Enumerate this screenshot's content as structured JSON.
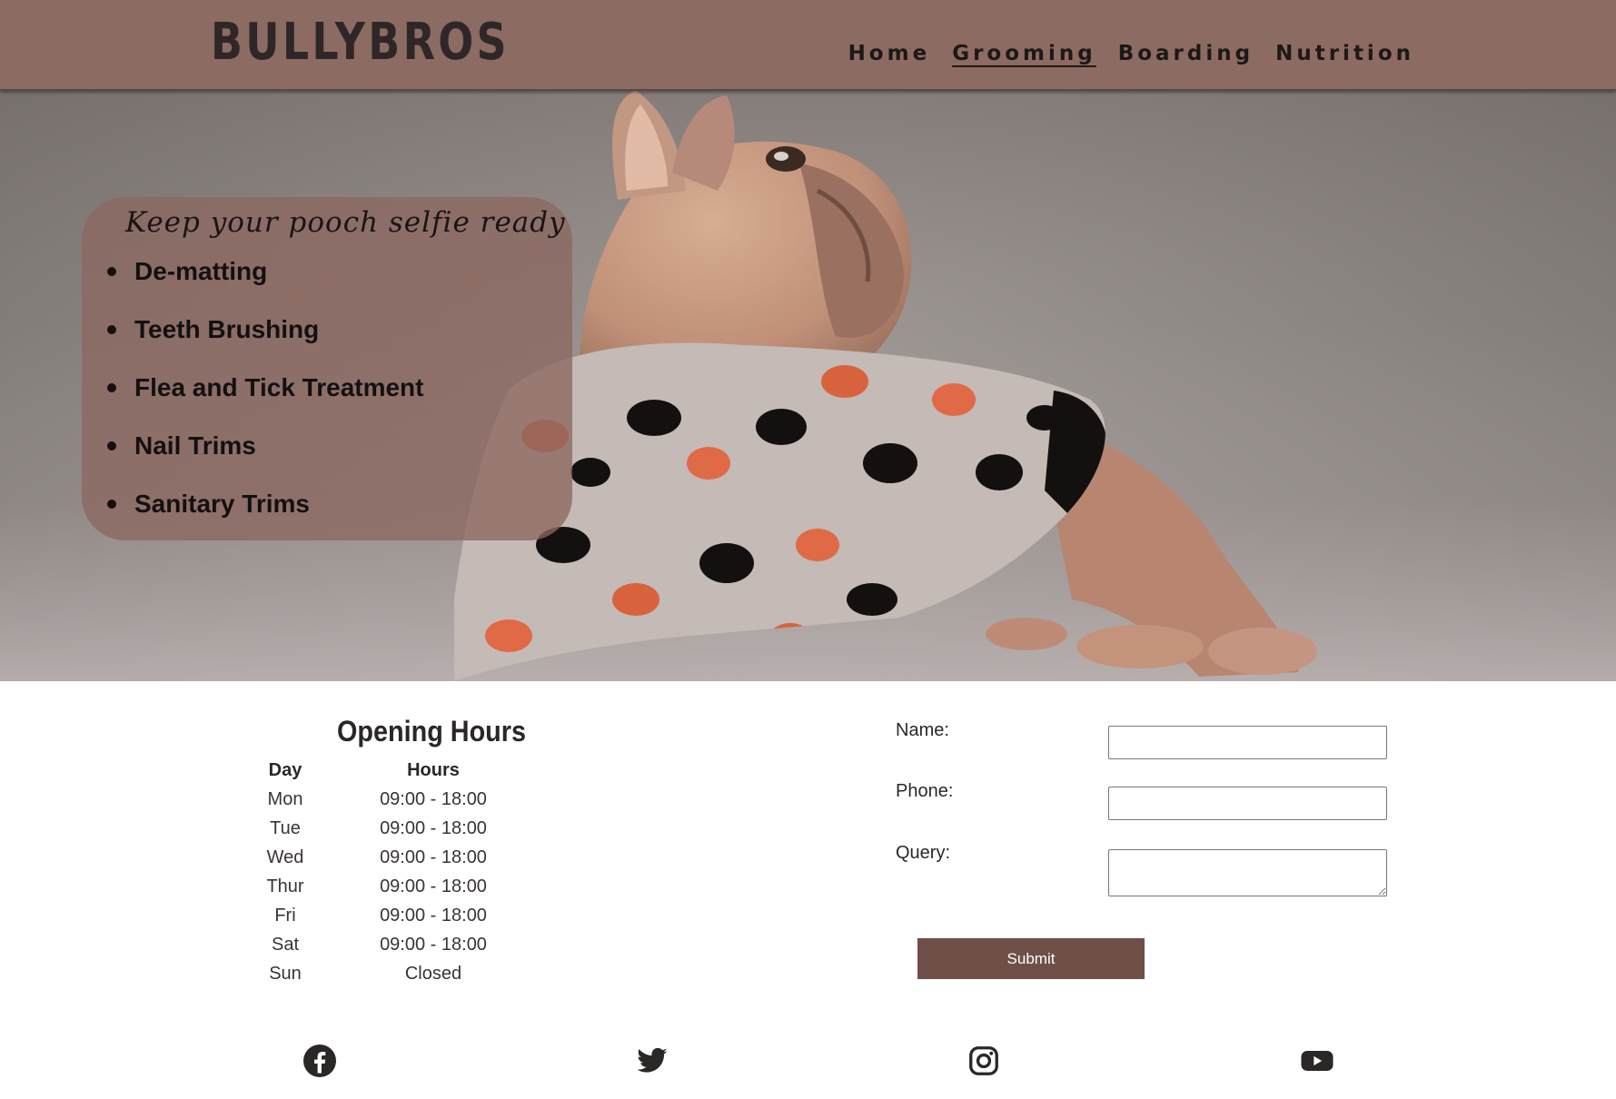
{
  "header": {
    "logo": "BULLYBROS",
    "nav": [
      {
        "label": "Home",
        "active": false
      },
      {
        "label": "Grooming",
        "active": true
      },
      {
        "label": "Boarding",
        "active": false
      },
      {
        "label": "Nutrition",
        "active": false
      }
    ]
  },
  "hero": {
    "tagline": "Keep your pooch selfie ready",
    "services": [
      "De-matting",
      "Teeth Brushing",
      "Flea and Tick Treatment",
      "Nail Trims",
      "Sanitary Trims"
    ]
  },
  "hours": {
    "title": "Opening Hours",
    "headers": [
      "Day",
      "Hours"
    ],
    "rows": [
      [
        "Mon",
        "09:00 - 18:00"
      ],
      [
        "Tue",
        "09:00 - 18:00"
      ],
      [
        "Wed",
        "09:00 - 18:00"
      ],
      [
        "Thur",
        "09:00 - 18:00"
      ],
      [
        "Fri",
        "09:00 - 18:00"
      ],
      [
        "Sat",
        "09:00 - 18:00"
      ],
      [
        "Sun",
        "Closed"
      ]
    ]
  },
  "form": {
    "name_label": "Name:",
    "phone_label": "Phone:",
    "query_label": "Query:",
    "name_value": "",
    "phone_value": "",
    "query_value": "",
    "submit_label": "Submit"
  },
  "social": [
    "facebook-icon",
    "twitter-icon",
    "instagram-icon",
    "youtube-icon"
  ],
  "colors": {
    "header_bg": "#8c6b62",
    "button_bg": "#6e5048",
    "text_dark": "#2b2727"
  }
}
